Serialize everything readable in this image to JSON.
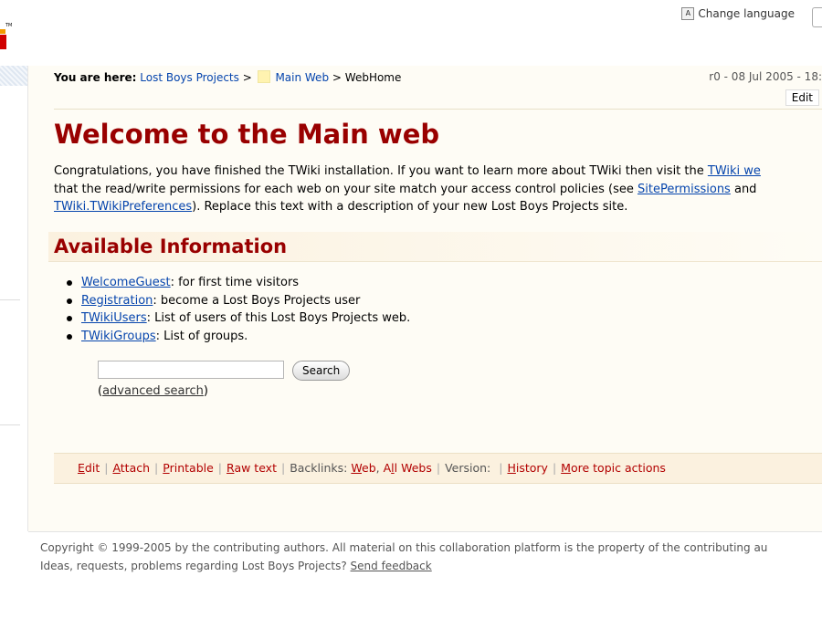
{
  "header": {
    "logo_tm": "TM",
    "change_language": "Change language"
  },
  "breadcrumb": {
    "prefix": "You are here:",
    "site": "Lost Boys Projects",
    "sep1": ">",
    "web": "Main Web",
    "sep2": ">",
    "topic": "WebHome"
  },
  "revision": "r0 - 08 Jul 2005 - 18:",
  "edit_button": "Edit",
  "title": "Welcome to the Main web",
  "intro": {
    "line1_text": "Congratulations, you have finished the TWiki installation. If you want to learn more about TWiki then visit the ",
    "line1_link": "TWiki we",
    "line2_text": "that the read/write permissions for each web on your site match your access control policies (see ",
    "line2_link": "SitePermissions",
    "line2_tail": " and",
    "line3_link": "TWiki.TWikiPreferences",
    "line3_text": "). Replace this text with a description of your new Lost Boys Projects site."
  },
  "available_heading": "Available Information",
  "info_items": [
    {
      "link": "WelcomeGuest",
      "text": ": for first time visitors"
    },
    {
      "link": "Registration",
      "text": ": become a Lost Boys Projects user"
    },
    {
      "link": "TWikiUsers",
      "text": ": List of users of this Lost Boys Projects web."
    },
    {
      "link": "TWikiGroups",
      "text": ": List of groups."
    }
  ],
  "search": {
    "value": "",
    "button": "Search",
    "advanced_open": "(",
    "advanced": "advanced search",
    "advanced_close": ")"
  },
  "actions": {
    "edit_u": "E",
    "edit": "dit",
    "attach_u": "A",
    "attach": "ttach",
    "printable_u": "P",
    "printable": "rintable",
    "raw_u": "R",
    "raw": "aw text",
    "backlinks": "Backlinks:",
    "web_u": "W",
    "web": "eb",
    "comma": ",",
    "allwebs_pre": "A",
    "allwebs_u": "l",
    "allwebs": "l Webs",
    "version": "Version:",
    "history_u": "H",
    "history": "istory",
    "more_u": "M",
    "more": "ore topic actions"
  },
  "footer": {
    "copyright": "Copyright © 1999-2005 by the contributing authors. All material on this collaboration platform is the property of the contributing au",
    "ideas": "Ideas, requests, problems regarding Lost Boys Projects? ",
    "feedback": "Send feedback"
  }
}
